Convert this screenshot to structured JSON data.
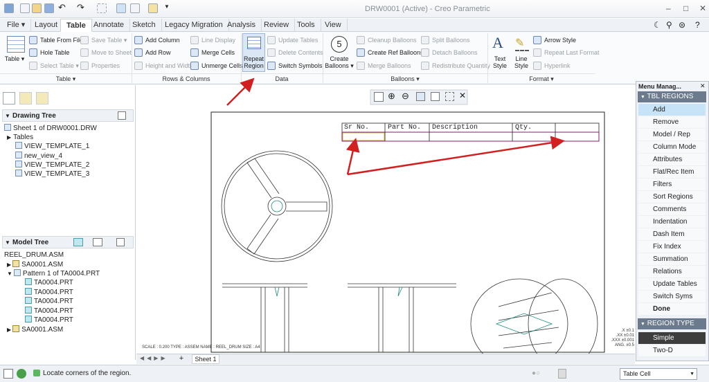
{
  "window": {
    "title": "DRW0001 (Active) - Creo Parametric",
    "min": "–",
    "max": "□",
    "close": "✕"
  },
  "quick_access": [
    "new-icon",
    "open-icon",
    "save-icon",
    "undo-icon",
    "redo-icon",
    "select-box-icon",
    "regenerate-icon",
    "windows-icon",
    "close-window-icon"
  ],
  "tabs": [
    "File ▾",
    "Layout",
    "Table",
    "Annotate",
    "Sketch",
    "Legacy Migration",
    "Analysis",
    "Review",
    "Tools",
    "View"
  ],
  "active_tab": "Table",
  "ribbon": {
    "table_group": {
      "table": "Table",
      "table_from_file": "Table From File",
      "hole_table": "Hole Table",
      "select_table": "Select Table",
      "save_table": "Save Table",
      "move_to_sheet": "Move to Sheet",
      "properties": "Properties",
      "label": "Table"
    },
    "rows_group": {
      "add_column": "Add Column",
      "add_row": "Add Row",
      "height_width": "Height and Width",
      "line_display": "Line Display",
      "merge_cells": "Merge Cells",
      "unmerge_cells": "Unmerge Cells",
      "label": "Rows & Columns"
    },
    "data_group": {
      "repeat_region": "Repeat Region",
      "update_tables": "Update Tables",
      "delete_contents": "Delete Contents",
      "switch_symbols": "Switch Symbols",
      "label": "Data"
    },
    "balloons_group": {
      "create_balloons": "Create Balloons",
      "cleanup_balloons": "Cleanup Balloons",
      "create_ref_balloons": "Create Ref Balloons",
      "merge_balloons": "Merge Balloons",
      "split_balloons": "Split Balloons",
      "detach_balloons": "Detach Balloons",
      "redistribute_quantity": "Redistribute Quantity",
      "label": "Balloons",
      "badge": "5"
    },
    "format_group": {
      "text_style": "Text Style",
      "line_style": "Line Style",
      "arrow_style": "Arrow Style",
      "repeat_last_format": "Repeat Last Format",
      "hyperlink": "Hyperlink",
      "label": "Format"
    }
  },
  "drawing_tree": {
    "title": "Drawing Tree",
    "items": [
      "Sheet 1 of DRW0001.DRW",
      "Tables",
      "VIEW_TEMPLATE_1",
      "new_view_4",
      "VIEW_TEMPLATE_2",
      "VIEW_TEMPLATE_3"
    ]
  },
  "model_tree": {
    "title": "Model Tree",
    "items": [
      "REEL_DRUM.ASM",
      "SA0001.ASM",
      "Pattern 1 of TA0004.PRT",
      "TA0004.PRT",
      "TA0004.PRT",
      "TA0004.PRT",
      "TA0004.PRT",
      "TA0004.PRT",
      "SA0001.ASM"
    ]
  },
  "table": {
    "headers": [
      "Sr  No.",
      "Part No.",
      "Description",
      "Qty.",
      ""
    ]
  },
  "sheet_footer": "SCALE : 0.200    TYPE : ASSEM    NAME : REEL_DRUM    SIZE : A4",
  "tolerance": [
    ".X  ±0.1",
    ".XX  ±0.01",
    ".XXX  ±0.001",
    "ANG.  ±0.5"
  ],
  "sheet_tab": "Sheet 1",
  "menu_manager": {
    "title": "Menu Manag...",
    "section1": "TBL REGIONS",
    "items1": [
      "Add",
      "Remove",
      "Model / Rep",
      "Column Mode",
      "Attributes",
      "Flat/Rec Item",
      "Filters",
      "Sort Regions",
      "Comments",
      "Indentation",
      "Dash Item",
      "Fix Index",
      "Summation",
      "Relations",
      "Update Tables",
      "Switch Syms",
      "Done"
    ],
    "section2": "REGION TYPE",
    "items2": [
      "Simple",
      "Two-D"
    ]
  },
  "status": {
    "message": "Locate corners of the region.",
    "filter": "Table Cell"
  },
  "colors": {
    "arrow": "#d21f1f",
    "table_region": "#8b1a6d",
    "accent": "#c7e3f7"
  }
}
